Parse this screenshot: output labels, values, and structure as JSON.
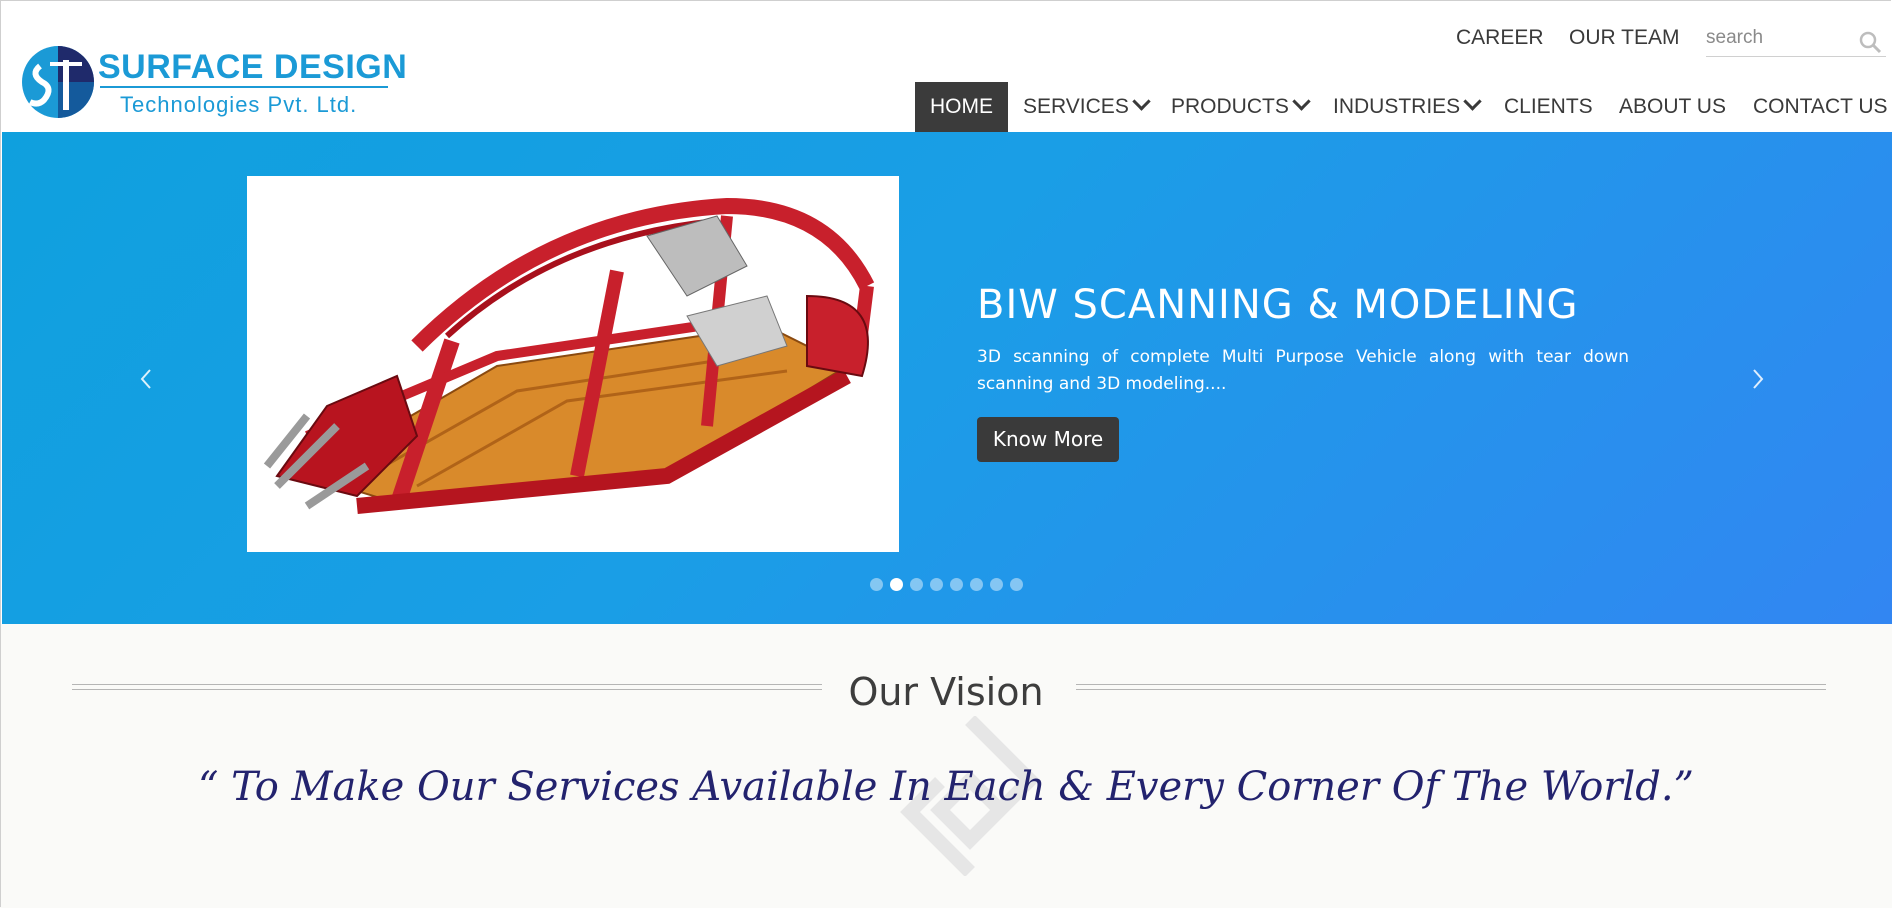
{
  "brand": {
    "name": "SURFACE DESIGN",
    "subtitle": "Technologies Pvt. Ltd.",
    "color": "#1b9ad6"
  },
  "top_links": [
    {
      "label": "CAREER"
    },
    {
      "label": "OUR TEAM"
    }
  ],
  "search": {
    "placeholder": "search",
    "icon": "search-icon"
  },
  "nav": {
    "items": [
      {
        "label": "HOME",
        "active": true,
        "dropdown": false
      },
      {
        "label": "SERVICES",
        "active": false,
        "dropdown": true
      },
      {
        "label": "PRODUCTS",
        "active": false,
        "dropdown": true
      },
      {
        "label": "INDUSTRIES",
        "active": false,
        "dropdown": true
      },
      {
        "label": "CLIENTS",
        "active": false,
        "dropdown": false
      },
      {
        "label": "ABOUT US",
        "active": false,
        "dropdown": false
      },
      {
        "label": "CONTACT US",
        "active": false,
        "dropdown": false
      }
    ]
  },
  "hero": {
    "title": "BIW SCANNING & MODELING",
    "description": "3D scanning of complete  Multi Purpose Vehicle along with tear down scanning and 3D modeling....",
    "button_label": "Know More",
    "image": "car-body-in-white-illustration",
    "slide_count": 8,
    "active_slide": 2,
    "colors": {
      "start": "#0fa0de",
      "end": "#3286f2",
      "button": "#3a3a3a"
    }
  },
  "vision": {
    "title": "Our Vision",
    "quote": "“ To Make Our Services Available In Each & Every Corner Of The World.”",
    "quote_color": "#23236e"
  }
}
